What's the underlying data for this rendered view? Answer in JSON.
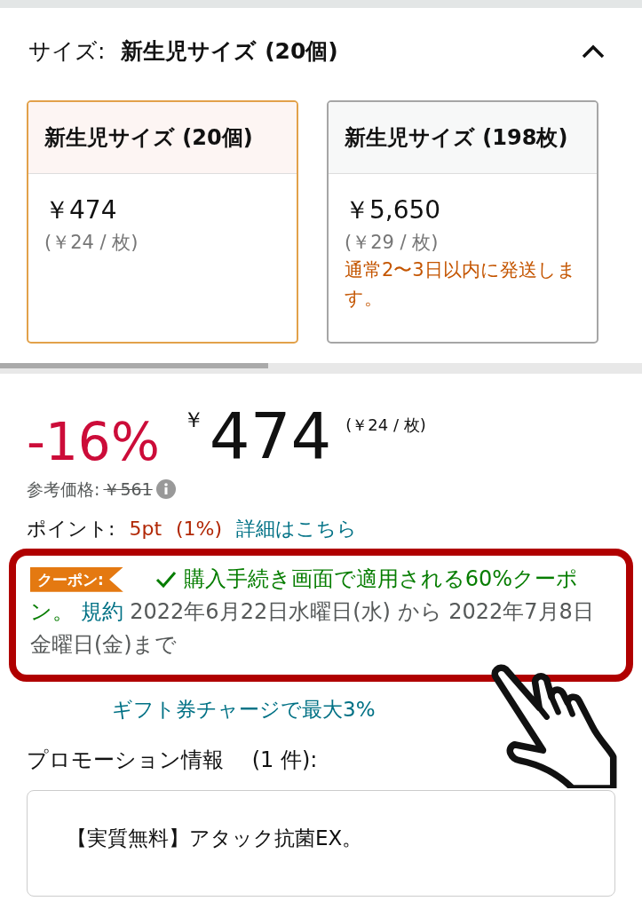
{
  "size_selector": {
    "label": "サイズ:",
    "value": "新生児サイズ (20個)",
    "expanded": true
  },
  "size_options": [
    {
      "name": "新生児サイズ (20個)",
      "price": "￥474",
      "unit_price": "(￥24 / 枚)",
      "selected": true
    },
    {
      "name": "新生児サイズ (198枚)",
      "price": "￥5,650",
      "unit_price": "(￥29 / 枚)",
      "shipping_note": "通常2〜3日以内に発送します。",
      "selected": false
    }
  ],
  "price": {
    "discount": "-16%",
    "currency": "￥",
    "amount": "474",
    "unit_price": "(￥24 / 枚)",
    "reference_label": "参考価格:",
    "reference_price": "￥561"
  },
  "points": {
    "label": "ポイント:",
    "points": "5pt",
    "percent": "(1%)",
    "details_link": "詳細はこちら"
  },
  "coupon": {
    "badge": "クーポン:",
    "checked": true,
    "text": "購入手続き画面で適用される60%クーポン。",
    "terms_link": "規約",
    "validity": "2022年6月22日水曜日(水) から 2022年7月8日金曜日(金)まで"
  },
  "gift_card_promo": "ギフト券チャージで最大3%",
  "promotions": {
    "heading": "プロモーション情報　 (1 件):",
    "items": [
      "【実質無料】アタック抗菌EX。"
    ]
  }
}
